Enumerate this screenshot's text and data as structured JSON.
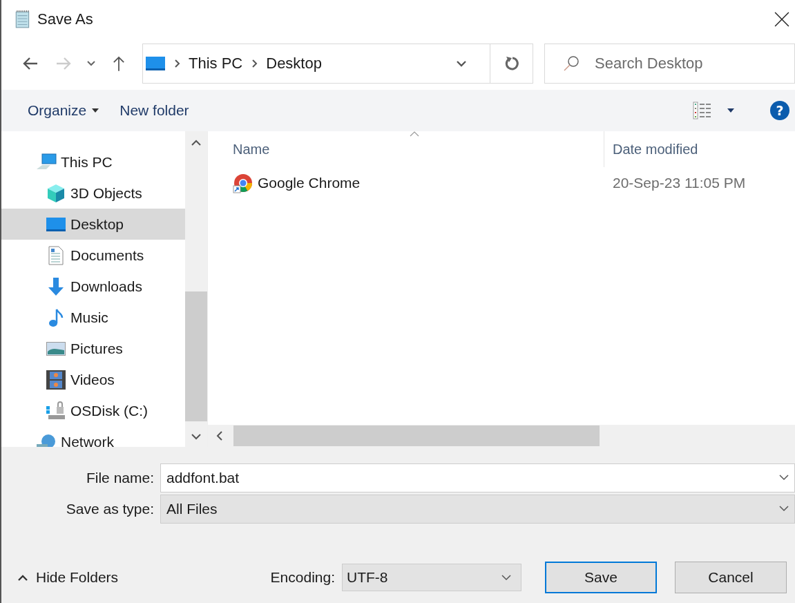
{
  "window": {
    "title": "Save As"
  },
  "nav": {
    "back_disabled": false,
    "forward_disabled": true,
    "breadcrumb": [
      "This PC",
      "Desktop"
    ],
    "search_placeholder": "Search Desktop"
  },
  "toolbar": {
    "organize": "Organize",
    "new_folder": "New folder",
    "help": "?"
  },
  "sidebar": {
    "items": [
      {
        "label": "This PC",
        "kind": "pc",
        "selected": false,
        "children": [
          {
            "label": "3D Objects",
            "kind": "cube",
            "selected": false
          },
          {
            "label": "Desktop",
            "kind": "desktop",
            "selected": true
          },
          {
            "label": "Documents",
            "kind": "document",
            "selected": false
          },
          {
            "label": "Downloads",
            "kind": "download",
            "selected": false
          },
          {
            "label": "Music",
            "kind": "music",
            "selected": false
          },
          {
            "label": "Pictures",
            "kind": "pictures",
            "selected": false
          },
          {
            "label": "Videos",
            "kind": "videos",
            "selected": false
          },
          {
            "label": "OSDisk (C:)",
            "kind": "disk",
            "selected": false
          }
        ]
      },
      {
        "label": "Network",
        "kind": "network",
        "selected": false
      }
    ]
  },
  "table": {
    "columns": [
      "Name",
      "Date modified"
    ],
    "rows": [
      {
        "name": "Google Chrome",
        "date": "20-Sep-23 11:05 PM",
        "selected": false
      }
    ]
  },
  "form": {
    "file_name_label": "File name:",
    "file_name": "addfont.bat",
    "type_label": "Save as type:",
    "type": "All Files"
  },
  "footer": {
    "hide_folders": "Hide Folders",
    "encoding_label": "Encoding:",
    "encoding": "UTF-8",
    "buttons": [
      {
        "label": "Save",
        "default": true
      },
      {
        "label": "Cancel",
        "default": false
      }
    ]
  }
}
